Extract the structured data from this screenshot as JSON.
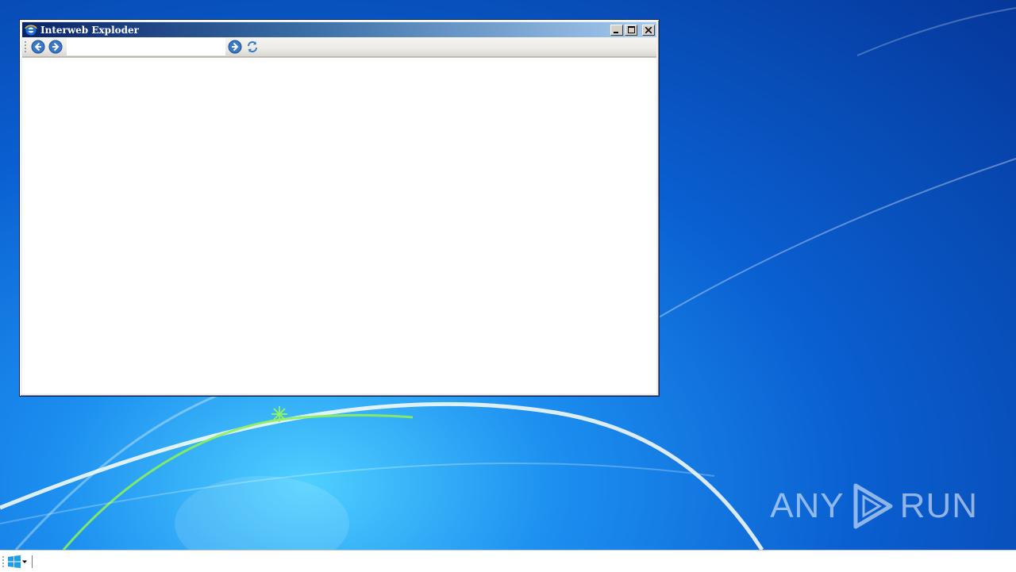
{
  "window": {
    "title": "Interweb Exploder",
    "buttons": {
      "minimize": "minimize",
      "maximize": "maximize",
      "close": "close"
    }
  },
  "toolbar": {
    "address": {
      "value": "",
      "placeholder": ""
    }
  },
  "watermark": {
    "text_left": "ANY",
    "text_right": "RUN"
  },
  "icons": {
    "back": "back-arrow-icon",
    "forward": "forward-arrow-icon",
    "go": "go-arrow-icon",
    "refresh": "refresh-icon",
    "start": "windows-logo-icon"
  },
  "colors": {
    "titlebar_start": "#0a246a",
    "titlebar_end": "#a6caf0",
    "nav_button": "#3a78c8",
    "start_logo": "#1e9ee8"
  }
}
